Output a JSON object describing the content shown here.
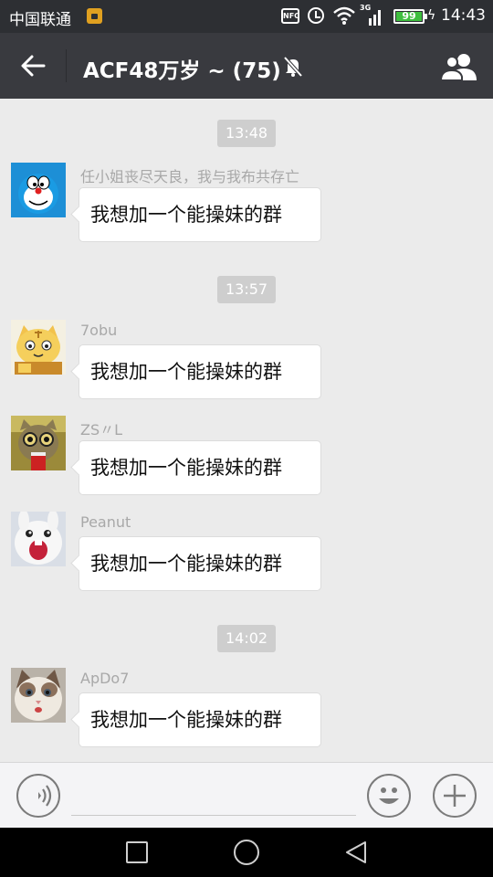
{
  "status_bar": {
    "carrier": "中国联通",
    "nfc_label": "NFC",
    "network_type": "3G",
    "battery_level": 99,
    "battery_label": "99",
    "time": "14:43"
  },
  "header": {
    "title": "ACF48万岁 ~ (75)",
    "icons": [
      "back-arrow-icon",
      "mute-bell-icon",
      "group-members-icon"
    ]
  },
  "chat": {
    "timestamps": [
      "13:48",
      "13:57",
      "14:02"
    ],
    "messages": [
      {
        "sender": "任小姐丧尽天良，我与我布共存亡",
        "text": "我想加一个能操妹的群",
        "avatar": "doraemon"
      },
      {
        "sender": "7obu",
        "text": "我想加一个能操妹的群",
        "avatar": "cartoon-tiger"
      },
      {
        "sender": "ZS〃L",
        "text": "我想加一个能操妹的群",
        "avatar": "cat-with-glasses"
      },
      {
        "sender": "Peanut",
        "text": "我想加一个能操妹的群",
        "avatar": "white-rabbit"
      },
      {
        "sender": "ApDo7",
        "text": "我想加一个能操妹的群",
        "avatar": "ragdoll-cat"
      }
    ]
  },
  "input_bar": {
    "placeholder": "",
    "icons": [
      "voice-icon",
      "emoji-icon",
      "plus-icon"
    ]
  },
  "nav_bar": {
    "icons": [
      "recent-apps-icon",
      "home-icon",
      "back-icon"
    ]
  },
  "colors": {
    "header_bg": "#393a3f",
    "status_bg": "#2d2f33",
    "chat_bg": "#ebebeb",
    "bubble_bg": "#ffffff",
    "timestamp_bg": "#cecece",
    "battery_green": "#3fbf3f"
  }
}
